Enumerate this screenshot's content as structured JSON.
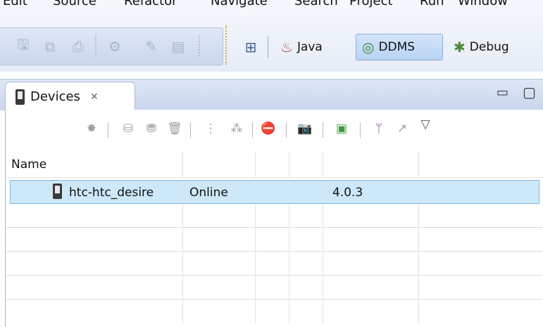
{
  "menu": [
    "Edit",
    "Source",
    "Refactor",
    "Navigate",
    "Search",
    "Project",
    "Run",
    "Window"
  ],
  "perspectives": [
    {
      "label": "Java",
      "icon": "java-perspective-icon",
      "active": false
    },
    {
      "label": "DDMS",
      "icon": "ddms-perspective-icon",
      "active": true
    },
    {
      "label": "Debug",
      "icon": "debug-perspective-icon",
      "active": false
    }
  ],
  "view": {
    "tab_label": "Devices",
    "tab_close": "✕"
  },
  "table": {
    "columns": [
      "Name",
      "",
      "",
      "",
      "",
      ""
    ],
    "rows": [
      {
        "name": "htc-htc_desire",
        "status": "Online",
        "col3": "",
        "version": "4.0.3",
        "selected": true
      }
    ]
  },
  "colors": {
    "selection": "#cde8f8",
    "selection_border": "#7db7e4",
    "toolbar_bg": "#dfe8f5"
  }
}
